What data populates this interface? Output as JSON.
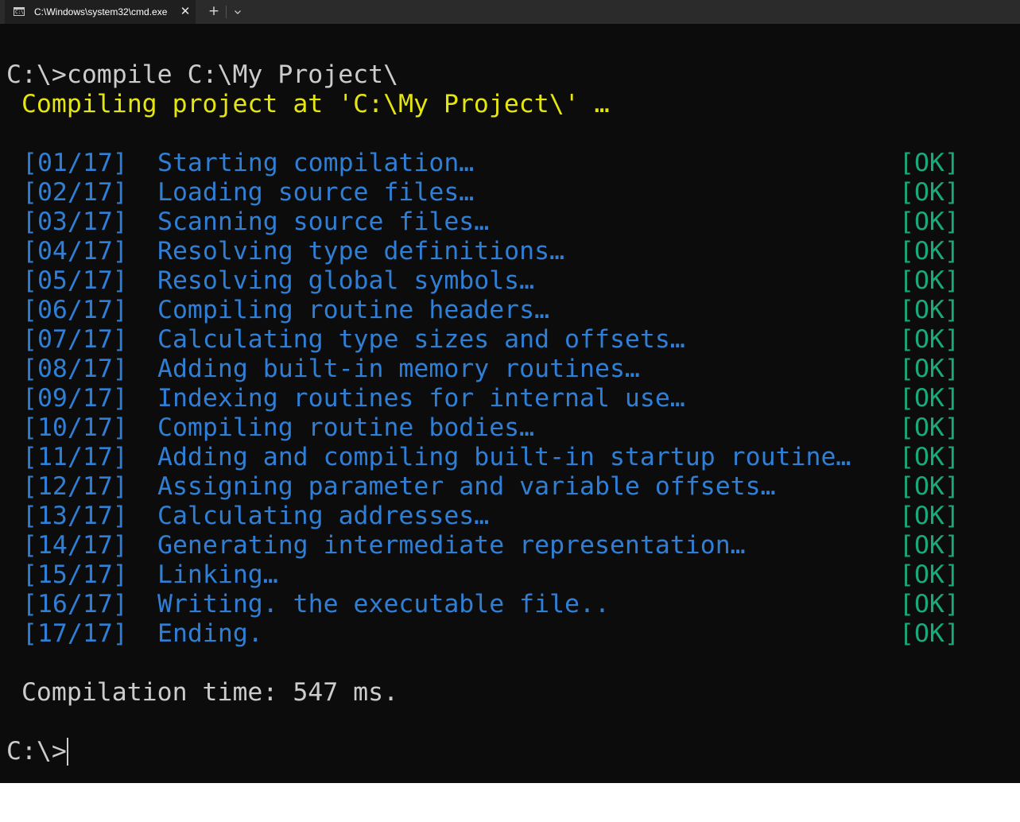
{
  "tab": {
    "title": "C:\\Windows\\system32\\cmd.exe",
    "close_glyph": "✕",
    "icon": "cmd-icon",
    "icon_prompt": "C:\\"
  },
  "tabbar": {
    "new_tab_glyph": "+",
    "dropdown_icon": "chevron-down-icon"
  },
  "colors": {
    "background": "#0c0c0c",
    "default_text": "#cccccc",
    "header_yellow": "#e5e510",
    "step_blue": "#2f7fd6",
    "ok_green": "#19a97a"
  },
  "terminal": {
    "command_line": "C:\\>compile C:\\My Project\\",
    "compiling_line": " Compiling project at 'C:\\My Project\\' …",
    "steps": [
      {
        "num": "[01/17]",
        "text": "Starting compilation…",
        "status": "[OK]"
      },
      {
        "num": "[02/17]",
        "text": "Loading source files…",
        "status": "[OK]"
      },
      {
        "num": "[03/17]",
        "text": "Scanning source files…",
        "status": "[OK]"
      },
      {
        "num": "[04/17]",
        "text": "Resolving type definitions…",
        "status": "[OK]"
      },
      {
        "num": "[05/17]",
        "text": "Resolving global symbols…",
        "status": "[OK]"
      },
      {
        "num": "[06/17]",
        "text": "Compiling routine headers…",
        "status": "[OK]"
      },
      {
        "num": "[07/17]",
        "text": "Calculating type sizes and offsets…",
        "status": "[OK]"
      },
      {
        "num": "[08/17]",
        "text": "Adding built-in memory routines…",
        "status": "[OK]"
      },
      {
        "num": "[09/17]",
        "text": "Indexing routines for internal use…",
        "status": "[OK]"
      },
      {
        "num": "[10/17]",
        "text": "Compiling routine bodies…",
        "status": "[OK]"
      },
      {
        "num": "[11/17]",
        "text": "Adding and compiling built-in startup routine…",
        "status": "[OK]"
      },
      {
        "num": "[12/17]",
        "text": "Assigning parameter and variable offsets…",
        "status": "[OK]"
      },
      {
        "num": "[13/17]",
        "text": "Calculating addresses…",
        "status": "[OK]"
      },
      {
        "num": "[14/17]",
        "text": "Generating intermediate representation…",
        "status": "[OK]"
      },
      {
        "num": "[15/17]",
        "text": "Linking…",
        "status": "[OK]"
      },
      {
        "num": "[16/17]",
        "text": "Writing. the executable file..",
        "status": "[OK]"
      },
      {
        "num": "[17/17]",
        "text": "Ending.",
        "status": "[OK]"
      }
    ],
    "compilation_time": " Compilation time: 547 ms.",
    "prompt": "C:\\>"
  }
}
